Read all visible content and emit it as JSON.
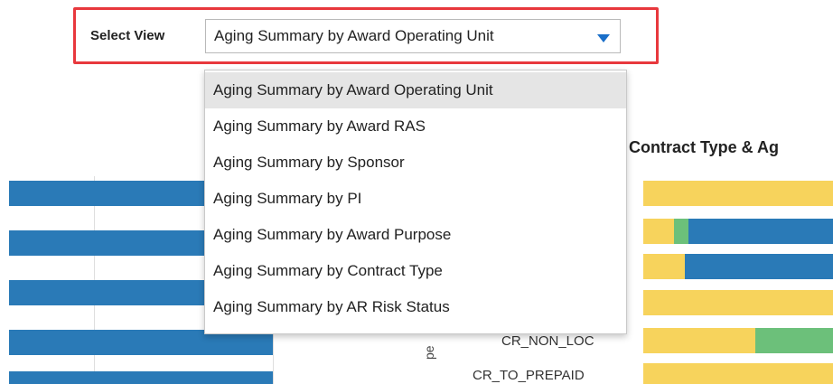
{
  "select_view": {
    "label": "Select View",
    "selected": "Aging Summary by Award Operating Unit"
  },
  "dropdown": {
    "options": [
      "Aging Summary by Award Operating Unit",
      "Aging Summary by Award RAS",
      "Aging Summary by Sponsor",
      "Aging Summary by PI",
      "Aging Summary by Award Purpose",
      "Aging Summary by Contract Type",
      "Aging Summary by AR Risk Status"
    ]
  },
  "background_chart": {
    "title_fragment": "Contract Type & Ag",
    "category_labels": [
      "CR_NON_LOC",
      "CR_TO_PREPAID"
    ],
    "axis_title_fragment": "pe",
    "colors": {
      "blue": "#2a7ab7",
      "yellow": "#f7d35c",
      "green": "#6cc07a"
    }
  },
  "colors": {
    "highlight": "#e8383d",
    "caret": "#1a6fc9",
    "selected_row": "#e5e5e5"
  }
}
